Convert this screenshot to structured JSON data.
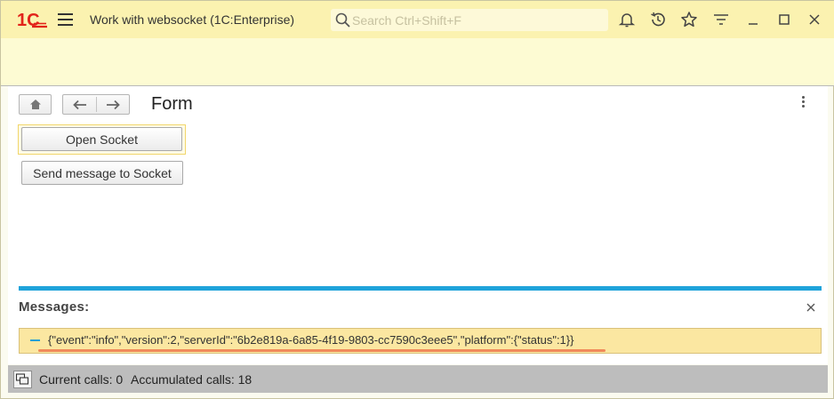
{
  "window": {
    "title": "Work with websocket  (1C:Enterprise)",
    "logo_text": "1C",
    "brand_color": "#e2231a",
    "accent_color": "#1fa3da",
    "search_placeholder": "Search Ctrl+Shift+F",
    "icons": [
      "menu-icon",
      "search-icon",
      "bell-icon",
      "history-icon",
      "star-icon",
      "filter-icon",
      "minimize-icon",
      "maximize-icon",
      "close-icon"
    ]
  },
  "form": {
    "title": "Form",
    "nav_icons": [
      "home-icon",
      "back-arrow-icon",
      "forward-arrow-icon",
      "more-vertical-icon"
    ],
    "open_socket_label": "Open Socket",
    "send_message_label": "Send message to Socket"
  },
  "messages": {
    "title": "Messages:",
    "items": [
      {
        "text": "{\"event\":\"info\",\"version\":2,\"serverId\":\"6b2e819a-6a85-4f19-9803-cc7590c3eee5\",\"platform\":{\"status\":1}}"
      }
    ]
  },
  "status_bar": {
    "current_calls": "Current calls: 0",
    "accumulated_calls": "Accumulated calls: 18"
  }
}
